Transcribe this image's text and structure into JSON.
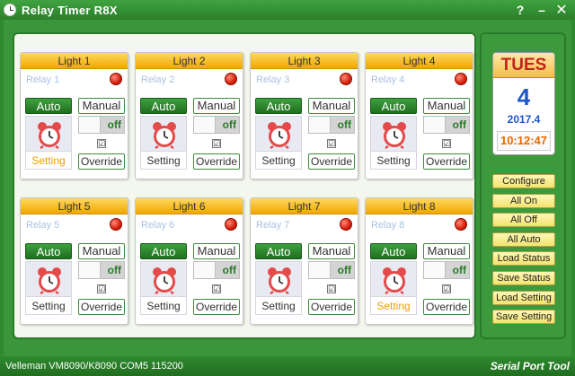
{
  "window": {
    "title": "Relay Timer R8X",
    "help_glyph": "?",
    "minimize_glyph": "–",
    "close_glyph": "✕"
  },
  "lights": [
    {
      "title": "Light 1",
      "relay": "Relay 1",
      "auto": "Auto",
      "manual": "Manual",
      "switch_state": "off",
      "checkbox": "☑",
      "setting": "Setting",
      "setting_active": true,
      "override": "Override"
    },
    {
      "title": "Light 2",
      "relay": "Relay 2",
      "auto": "Auto",
      "manual": "Manual",
      "switch_state": "off",
      "checkbox": "☑",
      "setting": "Setting",
      "setting_active": false,
      "override": "Override"
    },
    {
      "title": "Light 3",
      "relay": "Relay 3",
      "auto": "Auto",
      "manual": "Manual",
      "switch_state": "off",
      "checkbox": "☑",
      "setting": "Setting",
      "setting_active": false,
      "override": "Override"
    },
    {
      "title": "Light 4",
      "relay": "Relay 4",
      "auto": "Auto",
      "manual": "Manual",
      "switch_state": "off",
      "checkbox": "☑",
      "setting": "Setting",
      "setting_active": false,
      "override": "Override"
    },
    {
      "title": "Light 5",
      "relay": "Relay 5",
      "auto": "Auto",
      "manual": "Manual",
      "switch_state": "off",
      "checkbox": "☑",
      "setting": "Setting",
      "setting_active": false,
      "override": "Override"
    },
    {
      "title": "Light 6",
      "relay": "Relay 6",
      "auto": "Auto",
      "manual": "Manual",
      "switch_state": "off",
      "checkbox": "☑",
      "setting": "Setting",
      "setting_active": false,
      "override": "Override"
    },
    {
      "title": "Light 7",
      "relay": "Relay 7",
      "auto": "Auto",
      "manual": "Manual",
      "switch_state": "off",
      "checkbox": "☑",
      "setting": "Setting",
      "setting_active": false,
      "override": "Override"
    },
    {
      "title": "Light 8",
      "relay": "Relay 8",
      "auto": "Auto",
      "manual": "Manual",
      "switch_state": "off",
      "checkbox": "☑",
      "setting": "Setting",
      "setting_active": true,
      "override": "Override"
    }
  ],
  "clock": {
    "day": "TUES",
    "date": "4",
    "year_month": "2017.4",
    "time": "10:12:47"
  },
  "side_buttons": [
    "Configure",
    "All On",
    "All Off",
    "All Auto",
    "Load Status",
    "Save Status",
    "Load Setting",
    "Save Setting"
  ],
  "status": {
    "text": "Velleman VM8090/K8090 COM5 115200",
    "brand": "Serial Port Tool"
  },
  "colors": {
    "frame_green": "#2f8a2f",
    "header_gold": "#f0a800",
    "led_red": "#d8200c",
    "auto_green": "#1f6e1f",
    "active_orange": "#f0a000",
    "date_blue": "#1c57c8"
  }
}
